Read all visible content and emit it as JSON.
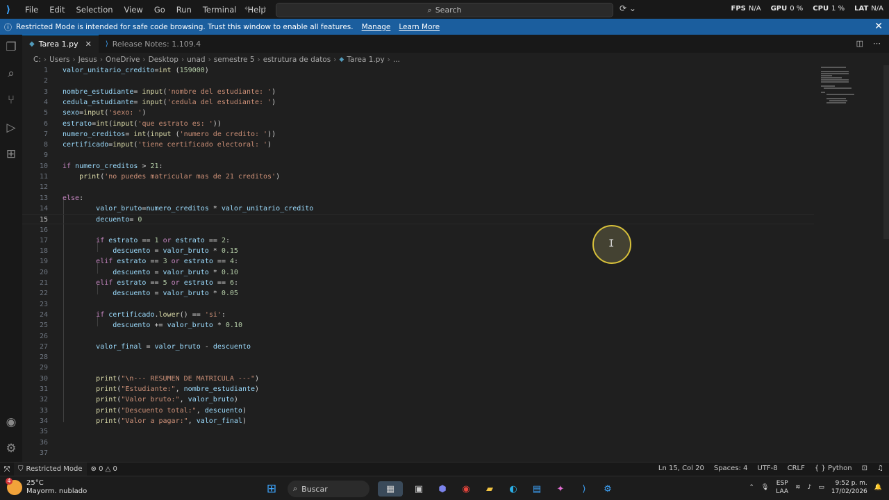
{
  "titlebar": {
    "menu": [
      "File",
      "Edit",
      "Selection",
      "View",
      "Go",
      "Run",
      "Terminal",
      "Help"
    ],
    "search_label": "Search",
    "perf": [
      {
        "label": "FPS",
        "value": "N/A"
      },
      {
        "label": "GPU",
        "value": "0 %"
      },
      {
        "label": "CPU",
        "value": "1 %"
      },
      {
        "label": "LAT",
        "value": "N/A"
      }
    ]
  },
  "banner": {
    "text": "Restricted Mode is intended for safe code browsing. Trust this window to enable all features.",
    "manage": "Manage",
    "learn_more": "Learn More"
  },
  "tabs": [
    {
      "label": "Tarea 1.py",
      "active": true
    },
    {
      "label": "Release Notes: 1.109.4",
      "active": false
    }
  ],
  "breadcrumb": [
    "C:",
    "Users",
    "Jesus",
    "OneDrive",
    "Desktop",
    "unad",
    "semestre 5",
    "estrutura de datos",
    "Tarea 1.py",
    "..."
  ],
  "editor": {
    "current_line": 15,
    "lines": [
      "valor_unitario_credito=int (159000)",
      "",
      "nombre_estudiante= input('nombre del estudiante: ')",
      "cedula_estudiante= input('cedula del estudiante: ')",
      "sexo=input('sexo: ')",
      "estrato=int(input('que estrato es: '))",
      "numero_creditos= int(input ('numero de credito: '))",
      "certificado=input('tiene certificado electoral: ')",
      "",
      "if numero_creditos > 21:",
      "    print('no puedes matricular mas de 21 creditos')",
      "",
      "else:",
      "        valor_bruto=numero_creditos * valor_unitario_credito",
      "        decuento= 0",
      "",
      "        if estrato == 1 or estrato == 2:",
      "            descuento = valor_bruto * 0.15",
      "        elif estrato == 3 or estrato == 4:",
      "            descuento = valor_bruto * 0.10",
      "        elif estrato == 5 or estrato == 6:",
      "            descuento = valor_bruto * 0.05",
      "",
      "        if certificado.lower() == 'si':",
      "            descuento += valor_bruto * 0.10",
      "",
      "        valor_final = valor_bruto - descuento",
      "",
      "",
      "        print(\"\\n--- RESUMEN DE MATRICULA ---\")",
      "        print(\"Estudiante:\", nombre_estudiante)",
      "        print(\"Valor bruto:\", valor_bruto)",
      "        print(\"Descuento total:\", descuento)",
      "        print(\"Valor a pagar:\", valor_final)",
      "",
      "",
      ""
    ]
  },
  "statusbar": {
    "restricted": "Restricted Mode",
    "errors": "0",
    "warnings": "0",
    "position": "Ln 15, Col 20",
    "spaces": "Spaces: 4",
    "encoding": "UTF-8",
    "eol": "CRLF",
    "language": "Python"
  },
  "taskbar": {
    "temp": "25°C",
    "weather": "Mayorm. nublado",
    "weather_badge": "4",
    "search": "Buscar",
    "lang_top": "ESP",
    "lang_bottom": "LAA",
    "time": "9:52 p. m.",
    "date": "17/02/2026"
  },
  "colors": {
    "accent": "#0078d4",
    "banner": "#1b5e9e",
    "keyword": "#c586c0",
    "string": "#ce9178",
    "function": "#dcdcaa"
  }
}
